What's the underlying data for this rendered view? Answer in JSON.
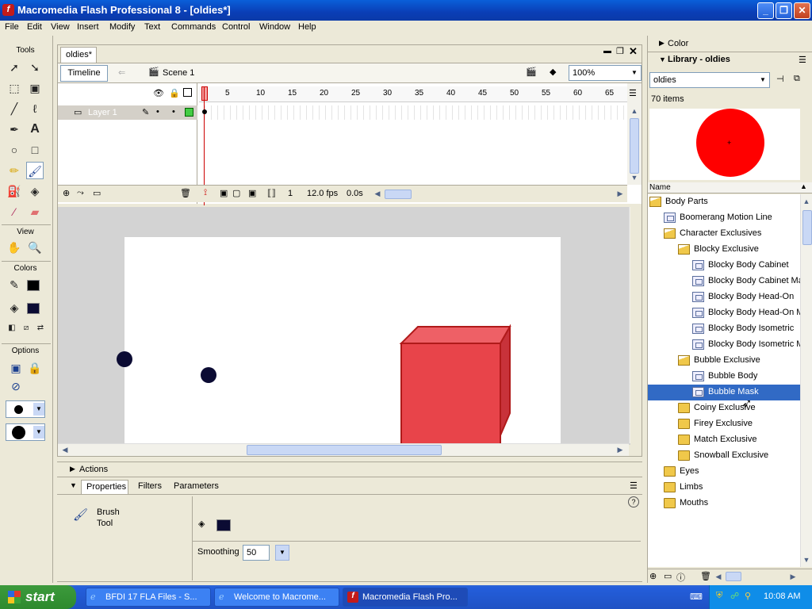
{
  "window": {
    "title": "Macromedia Flash Professional 8 - [oldies*]"
  },
  "menu": [
    "File",
    "Edit",
    "View",
    "Insert",
    "Modify",
    "Text",
    "Commands",
    "Control",
    "Window",
    "Help"
  ],
  "tools": {
    "header": "Tools",
    "view_header": "View",
    "colors_header": "Colors",
    "options_header": "Options"
  },
  "document": {
    "tab": "oldies*",
    "timeline_button": "Timeline",
    "scene": "Scene 1",
    "zoom": "100%",
    "layer": "Layer 1",
    "frame_numbers": [
      "1",
      "5",
      "10",
      "15",
      "20",
      "25",
      "30",
      "35",
      "40",
      "45",
      "50",
      "55",
      "60",
      "65"
    ],
    "current_frame": "1",
    "fps": "12.0 fps",
    "time": "0.0s"
  },
  "panels": {
    "actions": "Actions",
    "properties_tab": "Properties",
    "filters_tab": "Filters",
    "parameters_tab": "Parameters"
  },
  "properties": {
    "tool_name_line1": "Brush",
    "tool_name_line2": "Tool",
    "smoothing_label": "Smoothing",
    "smoothing_value": "50"
  },
  "right": {
    "color_label": "Color",
    "library_title": "Library - oldies",
    "library_select": "oldies",
    "item_count": "70 items",
    "name_header": "Name",
    "items": [
      {
        "label": "Body Parts",
        "type": "folder-open",
        "indent": 0
      },
      {
        "label": "Boomerang Motion Line",
        "type": "symbol",
        "indent": 1
      },
      {
        "label": "Character Exclusives",
        "type": "folder-open",
        "indent": 1
      },
      {
        "label": "Blocky Exclusive",
        "type": "folder-open",
        "indent": 2
      },
      {
        "label": "Blocky Body Cabinet",
        "type": "symbol",
        "indent": 3
      },
      {
        "label": "Blocky Body Cabinet Ma",
        "type": "symbol",
        "indent": 3
      },
      {
        "label": "Blocky Body Head-On",
        "type": "symbol",
        "indent": 3
      },
      {
        "label": "Blocky Body Head-On M",
        "type": "symbol",
        "indent": 3
      },
      {
        "label": "Blocky Body Isometric",
        "type": "symbol",
        "indent": 3
      },
      {
        "label": "Blocky Body Isometric M",
        "type": "symbol",
        "indent": 3
      },
      {
        "label": "Bubble Exclusive",
        "type": "folder-open",
        "indent": 2
      },
      {
        "label": "Bubble Body",
        "type": "symbol",
        "indent": 3
      },
      {
        "label": "Bubble Mask",
        "type": "symbol",
        "indent": 3,
        "selected": true
      },
      {
        "label": "Coiny Exclusive",
        "type": "folder",
        "indent": 2
      },
      {
        "label": "Firey Exclusive",
        "type": "folder",
        "indent": 2
      },
      {
        "label": "Match Exclusive",
        "type": "folder",
        "indent": 2
      },
      {
        "label": "Snowball Exclusive",
        "type": "folder",
        "indent": 2
      },
      {
        "label": "Eyes",
        "type": "folder",
        "indent": 1
      },
      {
        "label": "Limbs",
        "type": "folder",
        "indent": 1
      },
      {
        "label": "Mouths",
        "type": "folder",
        "indent": 1
      }
    ]
  },
  "taskbar": {
    "start": "start",
    "items": [
      "BFDI 17 FLA Files - S...",
      "Welcome to Macrome...",
      "Macromedia Flash Pro..."
    ],
    "clock": "10:08 AM"
  },
  "colors": {
    "titlebar": "#0a3eb6",
    "selection": "#316ac5",
    "stage_red": "#e8444a",
    "dot": "#0b0b33"
  }
}
